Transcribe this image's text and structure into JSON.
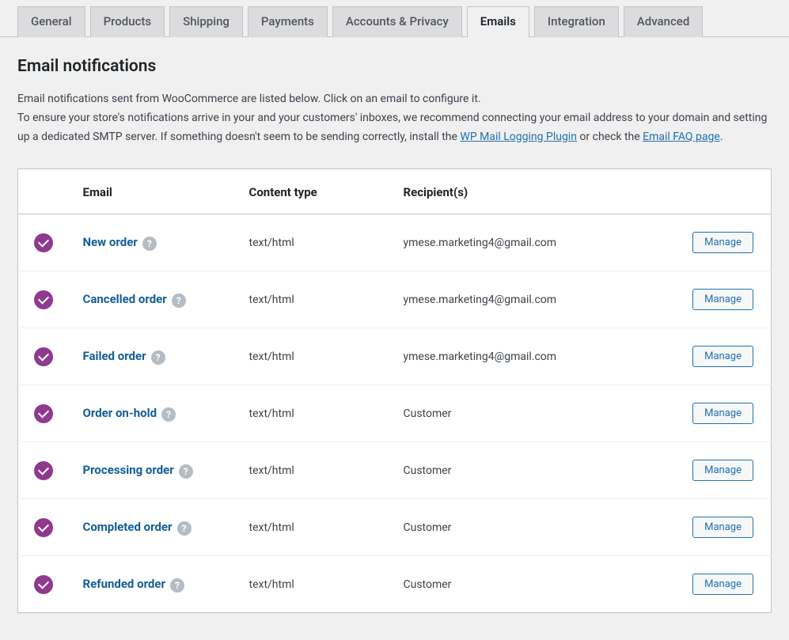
{
  "tabs": [
    {
      "label": "General"
    },
    {
      "label": "Products"
    },
    {
      "label": "Shipping"
    },
    {
      "label": "Payments"
    },
    {
      "label": "Accounts & Privacy"
    },
    {
      "label": "Emails",
      "active": true
    },
    {
      "label": "Integration"
    },
    {
      "label": "Advanced"
    }
  ],
  "heading": "Email notifications",
  "intro": {
    "line1": "Email notifications sent from WooCommerce are listed below. Click on an email to configure it.",
    "line2_a": "To ensure your store's notifications arrive in your and your customers' inboxes, we recommend connecting your email address to your domain and setting up a dedicated SMTP server. If something doesn't seem to be sending correctly, install the ",
    "link1": "WP Mail Logging Plugin",
    "line2_b": " or check the ",
    "link2": "Email FAQ page",
    "line2_c": "."
  },
  "table_headers": {
    "email": "Email",
    "content_type": "Content type",
    "recipients": "Recipient(s)"
  },
  "manage_label": "Manage",
  "emails": [
    {
      "name": "New order",
      "content_type": "text/html",
      "recipients": "ymese.marketing4@gmail.com"
    },
    {
      "name": "Cancelled order",
      "content_type": "text/html",
      "recipients": "ymese.marketing4@gmail.com"
    },
    {
      "name": "Failed order",
      "content_type": "text/html",
      "recipients": "ymese.marketing4@gmail.com"
    },
    {
      "name": "Order on-hold",
      "content_type": "text/html",
      "recipients": "Customer"
    },
    {
      "name": "Processing order",
      "content_type": "text/html",
      "recipients": "Customer"
    },
    {
      "name": "Completed order",
      "content_type": "text/html",
      "recipients": "Customer"
    },
    {
      "name": "Refunded order",
      "content_type": "text/html",
      "recipients": "Customer"
    }
  ]
}
